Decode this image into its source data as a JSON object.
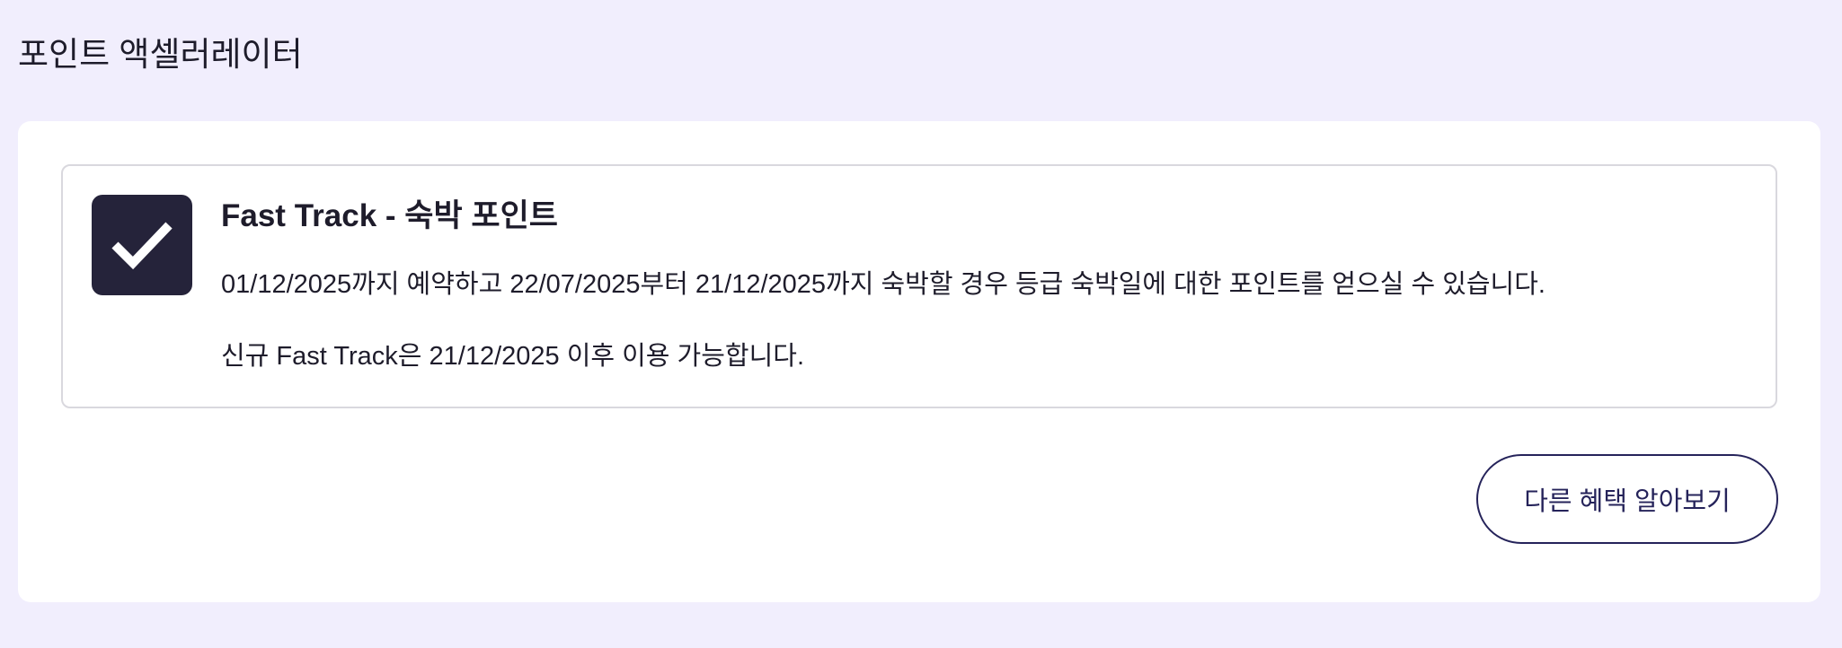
{
  "page": {
    "title": "포인트 액셀러레이터"
  },
  "offer": {
    "icon": "check-icon",
    "title": "Fast Track - 숙박 포인트",
    "description": "01/12/2025까지 예약하고 22/07/2025부터 21/12/2025까지 숙박할 경우 등급 숙박일에 대한 포인트를 얻으실 수 있습니다.",
    "note": "신규 Fast Track은 21/12/2025 이후 이용 가능합니다."
  },
  "actions": {
    "more_benefits_label": "다른 혜택 알아보기"
  },
  "colors": {
    "background": "#f1eefd",
    "panel": "#ffffff",
    "icon_tile": "#25233a",
    "button_border": "#25235a",
    "text": "#1e1c2b"
  }
}
